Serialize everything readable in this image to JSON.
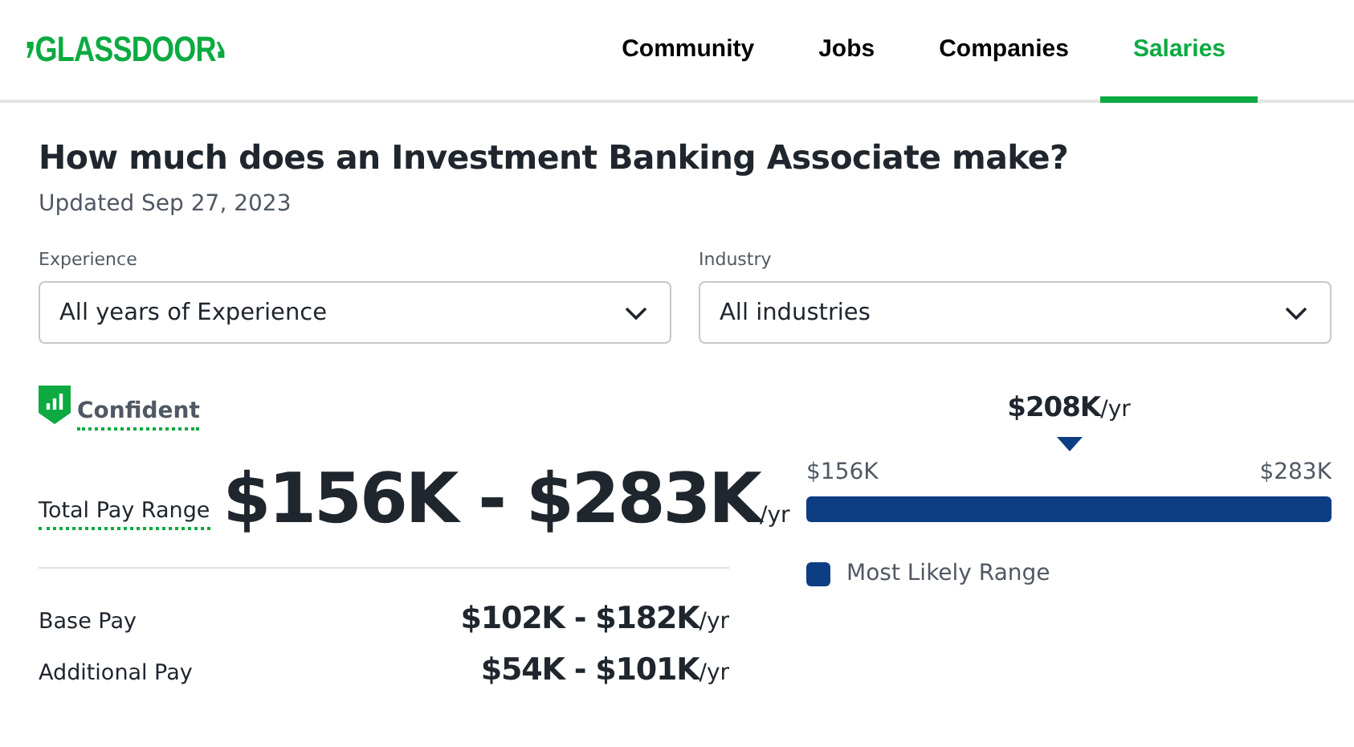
{
  "header": {
    "logo": "GLASSDOOR",
    "nav": [
      {
        "label": "Community",
        "selected": false
      },
      {
        "label": "Jobs",
        "selected": false
      },
      {
        "label": "Companies",
        "selected": false
      },
      {
        "label": "Salaries",
        "selected": true
      }
    ]
  },
  "title": "How much does an Investment Banking Associate make?",
  "updated": "Updated Sep 27, 2023",
  "filters": [
    {
      "label": "Experience",
      "value": "All years of Experience"
    },
    {
      "label": "Industry",
      "value": "All industries"
    }
  ],
  "confidence": "Confident",
  "total": {
    "label": "Total Pay Range",
    "range": "$156K - $283K",
    "unit": "/yr"
  },
  "breakdown": [
    {
      "label": "Base Pay",
      "range": "$102K - $182K",
      "unit": "/yr"
    },
    {
      "label": "Additional Pay",
      "range": "$54K - $101K",
      "unit": "/yr"
    }
  ],
  "range_bar": {
    "median": "$208K",
    "median_unit": "/yr",
    "low": "$156K",
    "high": "$283K",
    "legend": "Most Likely Range"
  }
}
